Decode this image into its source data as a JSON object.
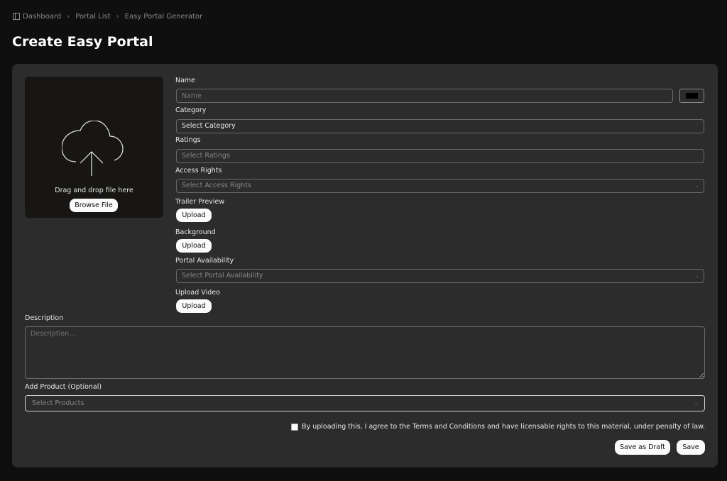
{
  "breadcrumb": {
    "items": [
      "Dashboard",
      "Portal List",
      "Easy Portal Generator"
    ],
    "separator": "›"
  },
  "page": {
    "title": "Create Easy Portal"
  },
  "upload": {
    "drop_text": "Drag and drop file here",
    "browse_label": "Browse File"
  },
  "form": {
    "name": {
      "label": "Name",
      "placeholder": "Name"
    },
    "color": {
      "value": "#000000"
    },
    "category": {
      "label": "Category",
      "value": "Select Category"
    },
    "ratings": {
      "label": "Ratings",
      "placeholder": "Select Ratings"
    },
    "access_rights": {
      "label": "Access Rights",
      "placeholder": "Select Access Rights"
    },
    "trailer_preview": {
      "label": "Trailer Preview",
      "button": "Upload"
    },
    "background": {
      "label": "Background",
      "button": "Upload"
    },
    "portal_availability": {
      "label": "Portal Availability",
      "placeholder": "Select Portal Availability"
    },
    "upload_video": {
      "label": "Upload Video",
      "button": "Upload"
    },
    "description": {
      "label": "Description",
      "placeholder": "Description..."
    },
    "add_product": {
      "label": "Add Product (Optional)",
      "placeholder": "Select Products"
    }
  },
  "agreement": {
    "text": "By uploading this, I agree to the Terms and Conditions and have licensable rights to this material, under penalty of law.",
    "checked": false
  },
  "actions": {
    "save_draft": "Save as Draft",
    "save": "Save"
  },
  "colors": {
    "background": "#0f0f10",
    "card": "#2c2c2c",
    "dropzone": "#171614",
    "button": "#fafafa"
  }
}
